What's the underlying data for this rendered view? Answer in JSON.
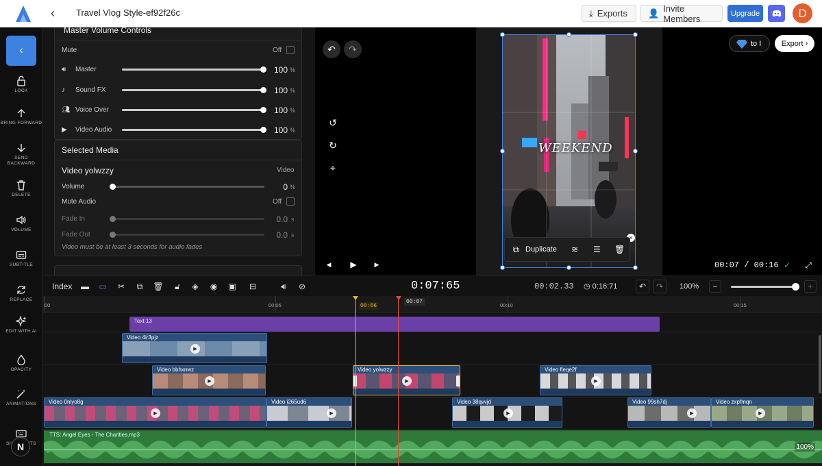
{
  "header": {
    "project_title": "Travel Vlog Style-ef92f26c",
    "exports_label": "Exports",
    "invite_label": "Invite Members",
    "upgrade_label": "Upgrade",
    "avatar_initial": "D"
  },
  "sidebar": {
    "items": [
      {
        "label": "LOCK",
        "icon": "lock-icon"
      },
      {
        "label": "BRING FORWARD",
        "icon": "arrow-up-icon"
      },
      {
        "label": "SEND BACKWARD",
        "icon": "arrow-down-icon"
      },
      {
        "label": "DELETE",
        "icon": "trash-icon"
      },
      {
        "label": "VOLUME",
        "icon": "volume-icon"
      },
      {
        "label": "SUBTITLE",
        "icon": "subtitle-icon"
      },
      {
        "label": "REPLACE",
        "icon": "replace-icon"
      },
      {
        "label": "EDIT WITH AI",
        "icon": "sparkles-icon"
      },
      {
        "label": "OPACITY",
        "icon": "drop-icon"
      },
      {
        "label": "ANIMATIONS",
        "icon": "wand-icon"
      },
      {
        "label": "SHORTCUTS",
        "icon": "keyboard-icon"
      }
    ],
    "badge_letter": "N"
  },
  "panel": {
    "master_section_title": "Master Volume Controls",
    "mute_label": "Mute",
    "mute_state": "Off",
    "volume_rows": [
      {
        "label": "Master",
        "value": "100",
        "unit": "%",
        "level": 1.0
      },
      {
        "label": "Sound FX",
        "value": "100",
        "unit": "%",
        "level": 1.0
      },
      {
        "label": "Voice Over",
        "value": "100",
        "unit": "%",
        "level": 1.0
      },
      {
        "label": "Video Audio",
        "value": "100",
        "unit": "%",
        "level": 1.0
      }
    ],
    "selected_media_title": "Selected Media",
    "media_name": "Video yolwzzy",
    "media_type": "Video",
    "volume_label": "Volume",
    "volume_value": "0",
    "volume_unit": "%",
    "mute_audio_label": "Mute Audio",
    "mute_audio_state": "Off",
    "fade_in_label": "Fade In",
    "fade_in_value": "0.0",
    "fade_out_label": "Fade Out",
    "fade_out_value": "0.0",
    "fade_unit": "s",
    "fade_note": "Video must be at least 3 seconds for audio fades"
  },
  "preview": {
    "overlay_text": "WEEKEND",
    "duplicate_label": "Duplicate",
    "diamond_label": "to I",
    "export_label": "Export",
    "current_time": "00:07",
    "total_time": "00:16"
  },
  "toolbar": {
    "index_label": "Index",
    "main_time": "0:07:65",
    "selection_time": "00:02.33",
    "duration": "0:16:71",
    "zoom": "100%"
  },
  "timeline": {
    "ruler_labels": [
      "00",
      "00:05",
      "00:10",
      "00:15"
    ],
    "playhead_label": "00:06",
    "cursor_label": "00:07",
    "text_clip_label": "Text 13",
    "clips": [
      {
        "name": "Video 4ir3pjz"
      },
      {
        "name": "Video bbhxnwz"
      },
      {
        "name": "Video yolwzzy"
      },
      {
        "name": "Video fleqe2f"
      },
      {
        "name": "Video 0nlyo8g"
      },
      {
        "name": "Video i265ud6"
      },
      {
        "name": "Video 38qvvjd"
      },
      {
        "name": "Video 99sh7dj"
      },
      {
        "name": "Video zxpfmqn"
      }
    ],
    "audio_label": "TTS: Angel Eyes - The Charities.mp3",
    "audio_volume": "100%"
  },
  "colors": {
    "accent": "#3d82e0",
    "text_clip": "#6b3fa8",
    "audio_track": "#2f7a3b",
    "playhead": "#e0b32b",
    "cursor": "#e04a3a"
  }
}
